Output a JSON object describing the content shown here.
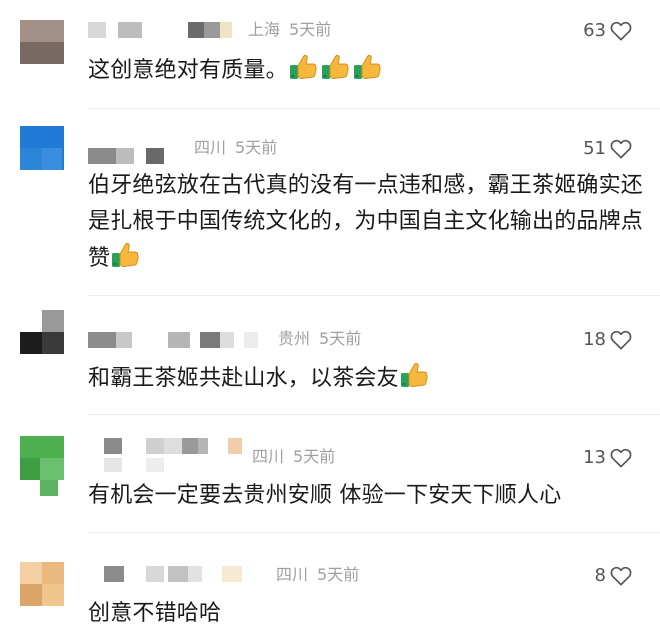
{
  "comments": [
    {
      "location": "上海",
      "time": "5天前",
      "likes": "63",
      "text": "这创意绝对有质量。",
      "emoji": [
        "thumbs-up",
        "thumbs-up",
        "thumbs-up"
      ]
    },
    {
      "location": "四川",
      "time": "5天前",
      "likes": "51",
      "text": "伯牙绝弦放在古代真的没有一点违和感，霸王茶姬确实还是扎根于中国传统文化的，为中国自主文化输出的品牌点赞",
      "emoji": [
        "thumbs-up"
      ]
    },
    {
      "location": "贵州",
      "time": "5天前",
      "likes": "18",
      "text": "和霸王茶姬共赴山水，以茶会友",
      "emoji": [
        "thumbs-up"
      ]
    },
    {
      "location": "四川",
      "time": "5天前",
      "likes": "13",
      "text": "有机会一定要去贵州安顺 体验一下安天下顺人心",
      "emoji": []
    },
    {
      "location": "四川",
      "time": "5天前",
      "likes": "8",
      "text": "创意不错哈哈",
      "emoji": []
    }
  ],
  "icons": {
    "like": "heart-outline-icon",
    "emoji": "thumbs-up-emoji-icon"
  },
  "colors": {
    "text": "#1a1a1a",
    "meta": "#a0a0a0",
    "like_count": "#555555",
    "emoji_hand": "#f6b73c",
    "emoji_sleeve": "#2aa15a"
  }
}
